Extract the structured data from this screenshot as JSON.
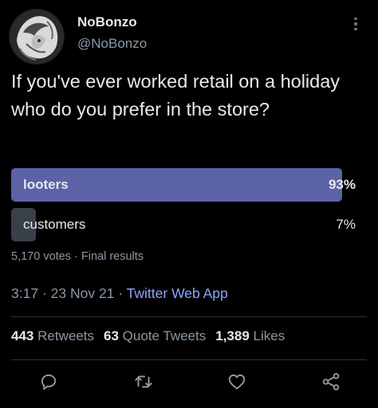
{
  "user": {
    "display_name": "NoBonzo",
    "handle": "@NoBonzo"
  },
  "tweet": {
    "text": "If you've ever worked retail on a holiday who do you prefer in the store?"
  },
  "poll": {
    "options": [
      {
        "label": "looters",
        "percent_text": "93%",
        "percent": 93,
        "winner": true
      },
      {
        "label": "customers",
        "percent_text": "7%",
        "percent": 7,
        "winner": false
      }
    ],
    "votes_text": "5,170 votes",
    "separator": "·",
    "status": "Final results"
  },
  "meta": {
    "time": "3:17",
    "sep": "·",
    "date": "23 Nov 21",
    "source": "Twitter Web App"
  },
  "stats": {
    "retweets_count": "443",
    "retweets_label": "Retweets",
    "quotes_count": "63",
    "quotes_label": "Quote Tweets",
    "likes_count": "1,389",
    "likes_label": "Likes"
  },
  "colors": {
    "background": "#000000",
    "winner_bar": "#5c62a6",
    "loser_bar": "#3a4048",
    "source_link": "#8fa3ff",
    "secondary_text": "#8b98a5"
  },
  "icons": [
    "more-icon",
    "reply-icon",
    "retweet-icon",
    "like-icon",
    "share-icon"
  ]
}
